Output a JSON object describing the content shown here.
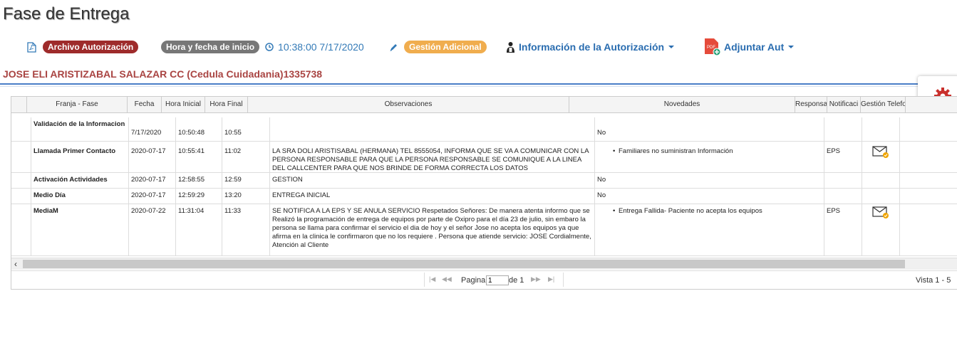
{
  "page": {
    "title": "Fase de Entrega"
  },
  "toolbar": {
    "archivo_label": "Archivo Autorización",
    "hora_label": "Hora y fecha de inicio",
    "hora_value": "10:38:00 7/17/2020",
    "gestion_label": "Gestión Adicional",
    "info_label": "Información de la Autorización",
    "adjuntar_label": "Adjuntar Aut"
  },
  "patient": {
    "name": "JOSE ELI ARISTIZABAL SALAZAR CC (Cedula Cuidadania)1335738"
  },
  "grid": {
    "headers": [
      "Franja - Fase",
      "Fecha",
      "Hora Inicial",
      "Hora Final",
      "Observaciones",
      "Novedades",
      "Responsa",
      "Notificaci",
      "Gestión Telefo"
    ],
    "rows": [
      {
        "fase": "Validación de la Informacion",
        "fecha": "7/17/2020",
        "hora_ini": "10:50:48",
        "hora_fin": "10:55",
        "obs": "",
        "nov": "No",
        "nov_list": false,
        "resp": "",
        "mail": false
      },
      {
        "fase": "Llamada Primer Contacto",
        "fecha": "2020-07-17",
        "hora_ini": "10:55:41",
        "hora_fin": "11:02",
        "obs": "LA SRA DOLI ARISTISABAL (HERMANA) TEL 8555054, INFORMA QUE SE VA A COMUNICAR CON LA PERSONA RESPONSABLE PARA QUE LA PERSONA RESPONSABLE SE COMUNIQUE A LA LINEA DEL CALLCENTER PARA QUE NOS BRINDE DE FORMA CORRECTA LOS DATOS",
        "nov": "Familiares no suministran Información",
        "nov_list": true,
        "resp": "EPS",
        "mail": true
      },
      {
        "fase": "Activación Actividades",
        "fecha": "2020-07-17",
        "hora_ini": "12:58:55",
        "hora_fin": "12:59",
        "obs": "GESTION",
        "nov": "No",
        "nov_list": false,
        "resp": "",
        "mail": false
      },
      {
        "fase": "Medio Día",
        "fecha": "2020-07-17",
        "hora_ini": "12:59:29",
        "hora_fin": "13:20",
        "obs": "ENTREGA INICIAL",
        "nov": "No",
        "nov_list": false,
        "resp": "",
        "mail": false
      },
      {
        "fase": "MediaM",
        "fecha": "2020-07-22",
        "hora_ini": "11:31:04",
        "hora_fin": "11:33",
        "obs": "SE NOTIFICA A LA EPS Y SE ANULA SERVICIO Respetados Señores: De manera atenta informo que se Realizó la programación de entrega de equipos por parte de Oxipro para el día 23 de julio, sin embaro la persona se llama para confirmar el servicio el dia de hoy y el señor Jose no acepta los equipos ya que afirma en la clinica le confirmaron que no los requiere . Persona que atiende servicio: JOSE Cordialmente, Atención al Cliente",
        "nov": "Entrega Fallida- Paciente no acepta los equipos",
        "nov_list": true,
        "resp": "EPS",
        "mail": true
      }
    ]
  },
  "pager": {
    "page_label": "Pagina",
    "page_value": "1",
    "of_label": "de 1",
    "view_label": "Vista 1 - 5"
  },
  "colors": {
    "accent": "#337ab7",
    "patient": "#a94442",
    "gear": "#c9302c"
  }
}
